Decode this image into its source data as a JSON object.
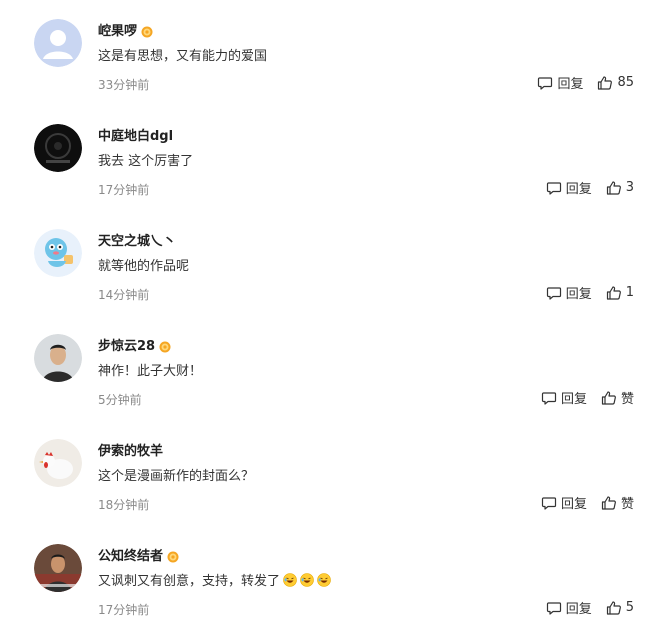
{
  "comments": [
    {
      "username": "崆果啰",
      "vip": true,
      "text": "这是有思想，又有能力的爱国",
      "time": "33分钟前",
      "reply_label": "回复",
      "like_count": "85",
      "emoji_count": 0,
      "avatar": "default-avatar"
    },
    {
      "username": "中庭地白dgl",
      "vip": false,
      "text": "我去 这个厉害了",
      "time": "17分钟前",
      "reply_label": "回复",
      "like_count": "3",
      "emoji_count": 0,
      "avatar": "dark-avatar"
    },
    {
      "username": "天空之城乀丶",
      "vip": false,
      "text": "就等他的作品呢",
      "time": "14分钟前",
      "reply_label": "回复",
      "like_count": "1",
      "emoji_count": 0,
      "avatar": "cartoon-avatar"
    },
    {
      "username": "步惊云28",
      "vip": true,
      "text": "神作！此子大财！",
      "time": "5分钟前",
      "reply_label": "回复",
      "like_count": "赞",
      "emoji_count": 0,
      "avatar": "photo-man-avatar"
    },
    {
      "username": "伊索的牧羊",
      "vip": false,
      "text": "这个是漫画新作的封面么？",
      "time": "18分钟前",
      "reply_label": "回复",
      "like_count": "赞",
      "emoji_count": 0,
      "avatar": "rooster-avatar"
    },
    {
      "username": "公知终结者",
      "vip": true,
      "text": "又讽刺又有创意，支持，转发了",
      "time": "17分钟前",
      "reply_label": "回复",
      "like_count": "5",
      "emoji_count": 3,
      "avatar": "photo-man2-avatar"
    }
  ],
  "icons": {
    "reply": "comment-bubble-icon",
    "like": "thumbs-up-icon",
    "vip": "vip-badge-icon",
    "emoji": "laughing-emoji-icon"
  },
  "colors": {
    "username": "#222222",
    "text": "#333333",
    "timestamp": "#8a8a8a",
    "vip_badge": "#f5a623"
  }
}
